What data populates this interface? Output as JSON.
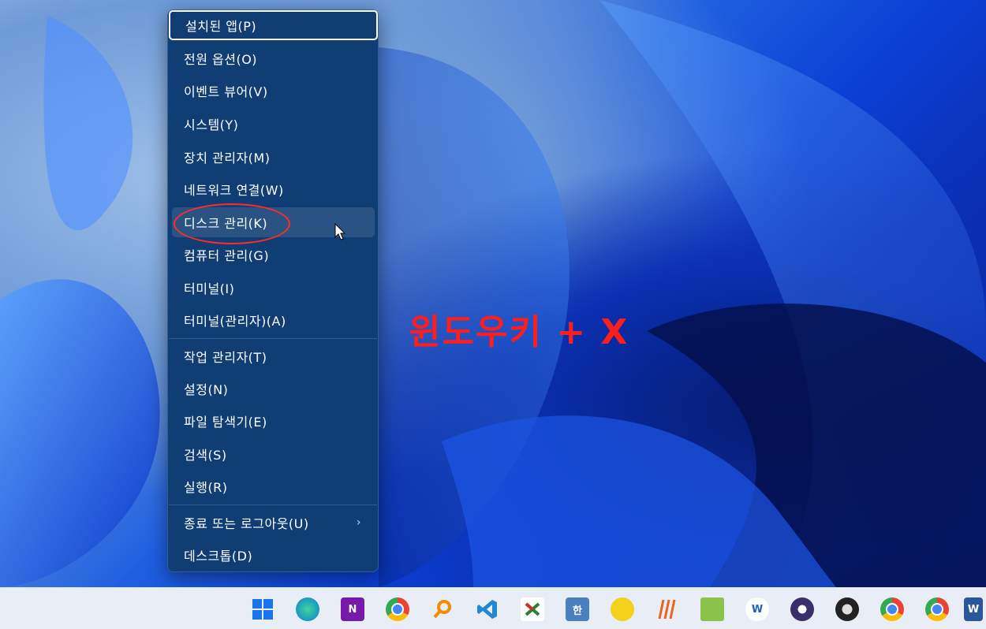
{
  "menu": {
    "items": [
      {
        "label": "설치된 앱(P)",
        "name": "menu-item-installed-apps"
      },
      {
        "label": "전원 옵션(O)",
        "name": "menu-item-power-options"
      },
      {
        "label": "이벤트 뷰어(V)",
        "name": "menu-item-event-viewer"
      },
      {
        "label": "시스템(Y)",
        "name": "menu-item-system"
      },
      {
        "label": "장치 관리자(M)",
        "name": "menu-item-device-manager"
      },
      {
        "label": "네트워크 연결(W)",
        "name": "menu-item-network-connections"
      },
      {
        "label": "디스크 관리(K)",
        "name": "menu-item-disk-management"
      },
      {
        "label": "컴퓨터 관리(G)",
        "name": "menu-item-computer-management"
      },
      {
        "label": "터미널(I)",
        "name": "menu-item-terminal"
      },
      {
        "label": "터미널(관리자)(A)",
        "name": "menu-item-terminal-admin"
      },
      {
        "label": "작업 관리자(T)",
        "name": "menu-item-task-manager"
      },
      {
        "label": "설정(N)",
        "name": "menu-item-settings"
      },
      {
        "label": "파일 탐색기(E)",
        "name": "menu-item-file-explorer"
      },
      {
        "label": "검색(S)",
        "name": "menu-item-search"
      },
      {
        "label": "실행(R)",
        "name": "menu-item-run"
      },
      {
        "label": "종료 또는 로그아웃(U)",
        "name": "menu-item-shutdown-signout"
      },
      {
        "label": "데스크톱(D)",
        "name": "menu-item-desktop"
      }
    ],
    "submenu_arrow": "›"
  },
  "annotation": {
    "text": "윈도우키 + X",
    "color": "#ff1e1e"
  },
  "taskbar": {
    "icons": [
      {
        "name": "start-icon"
      },
      {
        "name": "edge-icon"
      },
      {
        "name": "onenote-icon",
        "glyph": "N"
      },
      {
        "name": "chrome-icon"
      },
      {
        "name": "search-app-icon"
      },
      {
        "name": "vscode-icon"
      },
      {
        "name": "app-icon-1"
      },
      {
        "name": "hangul-icon",
        "glyph": "한"
      },
      {
        "name": "audio-app-icon"
      },
      {
        "name": "app-icon-2"
      },
      {
        "name": "notepad-icon"
      },
      {
        "name": "app-icon-3",
        "glyph": "W"
      },
      {
        "name": "app-icon-4"
      },
      {
        "name": "obs-icon"
      },
      {
        "name": "chrome-icon-2"
      },
      {
        "name": "chrome-icon-3"
      },
      {
        "name": "word-icon",
        "glyph": "W"
      }
    ]
  },
  "colors": {
    "menu_bg": "#0f3d74",
    "accent": "#ff1e1e",
    "taskbar_bg": "#e9eef6"
  }
}
